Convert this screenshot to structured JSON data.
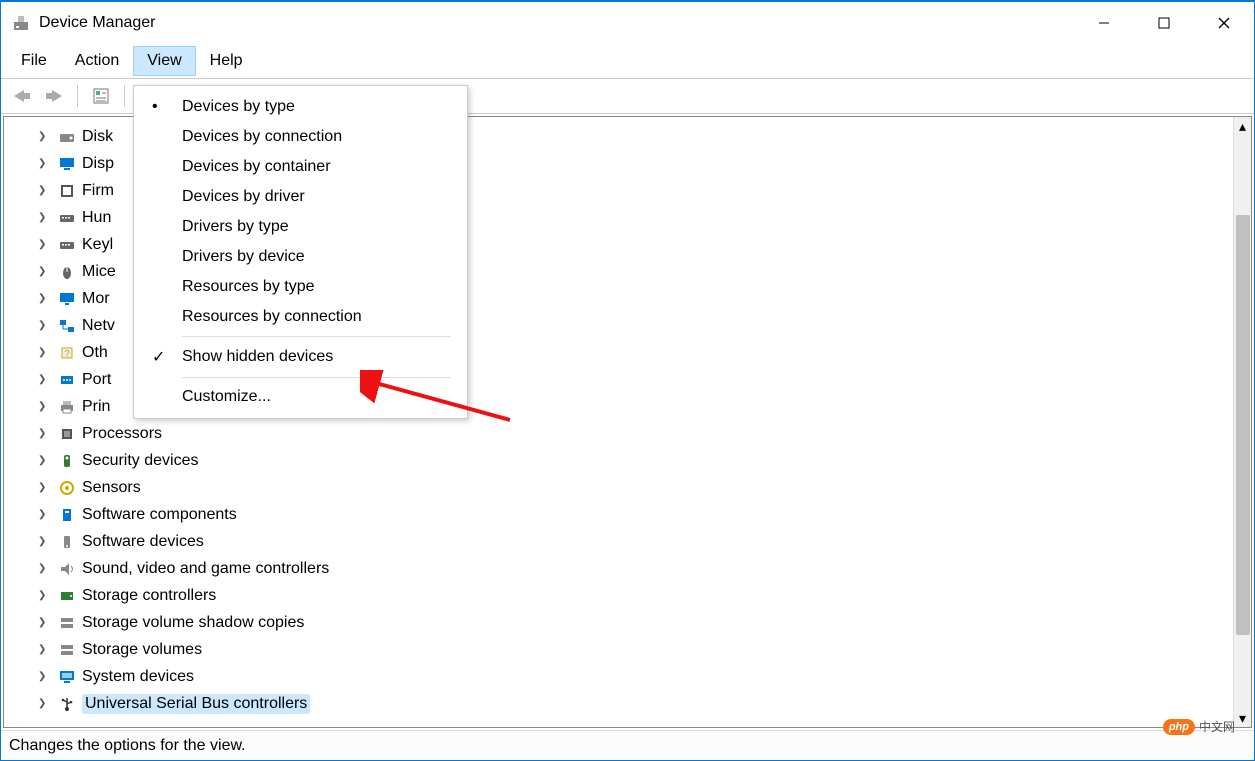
{
  "title": "Device Manager",
  "menus": {
    "file": "File",
    "action": "Action",
    "view": "View",
    "help": "Help"
  },
  "status": "Changes the options for the view.",
  "dropdown": {
    "devices_by_type": "Devices by type",
    "devices_by_connection": "Devices by connection",
    "devices_by_container": "Devices by container",
    "devices_by_driver": "Devices by driver",
    "drivers_by_type": "Drivers by type",
    "drivers_by_device": "Drivers by device",
    "resources_by_type": "Resources by type",
    "resources_by_connection": "Resources by connection",
    "show_hidden": "Show hidden devices",
    "customize": "Customize..."
  },
  "tree": [
    {
      "label": "Disk",
      "icon": "disk",
      "color": "#888"
    },
    {
      "label": "Disp",
      "icon": "display",
      "color": "#0078d4"
    },
    {
      "label": "Firm",
      "icon": "firmware",
      "color": "#555"
    },
    {
      "label": "Hun",
      "icon": "keyboard",
      "color": "#666"
    },
    {
      "label": "Keyl",
      "icon": "keyboard",
      "color": "#666"
    },
    {
      "label": "Mice",
      "icon": "mouse",
      "color": "#666"
    },
    {
      "label": "Mor",
      "icon": "monitor",
      "color": "#0078d4"
    },
    {
      "label": "Netv",
      "icon": "network",
      "color": "#0078d4"
    },
    {
      "label": "Oth",
      "icon": "other",
      "color": "#ccaa00"
    },
    {
      "label": "Port",
      "icon": "port",
      "color": "#0078d4"
    },
    {
      "label": "Prin",
      "icon": "printer",
      "color": "#888"
    },
    {
      "label": "Processors",
      "icon": "cpu",
      "color": "#555",
      "full": true
    },
    {
      "label": "Security devices",
      "icon": "security",
      "color": "#2e7d32",
      "full": true
    },
    {
      "label": "Sensors",
      "icon": "sensor",
      "color": "#ccaa00",
      "full": true
    },
    {
      "label": "Software components",
      "icon": "sw-comp",
      "color": "#0078d4",
      "full": true
    },
    {
      "label": "Software devices",
      "icon": "sw-dev",
      "color": "#888",
      "full": true
    },
    {
      "label": "Sound, video and game controllers",
      "icon": "sound",
      "color": "#888",
      "full": true
    },
    {
      "label": "Storage controllers",
      "icon": "storage-ctrl",
      "color": "#2e7d32",
      "full": true
    },
    {
      "label": "Storage volume shadow copies",
      "icon": "storage-vol",
      "color": "#888",
      "full": true
    },
    {
      "label": "Storage volumes",
      "icon": "storage-vol",
      "color": "#888",
      "full": true
    },
    {
      "label": "System devices",
      "icon": "system",
      "color": "#0078d4",
      "full": true
    },
    {
      "label": "Universal Serial Bus controllers",
      "icon": "usb",
      "color": "#333",
      "full": true,
      "selected": true
    }
  ],
  "watermark": {
    "logo": "php",
    "text": "中文网"
  }
}
